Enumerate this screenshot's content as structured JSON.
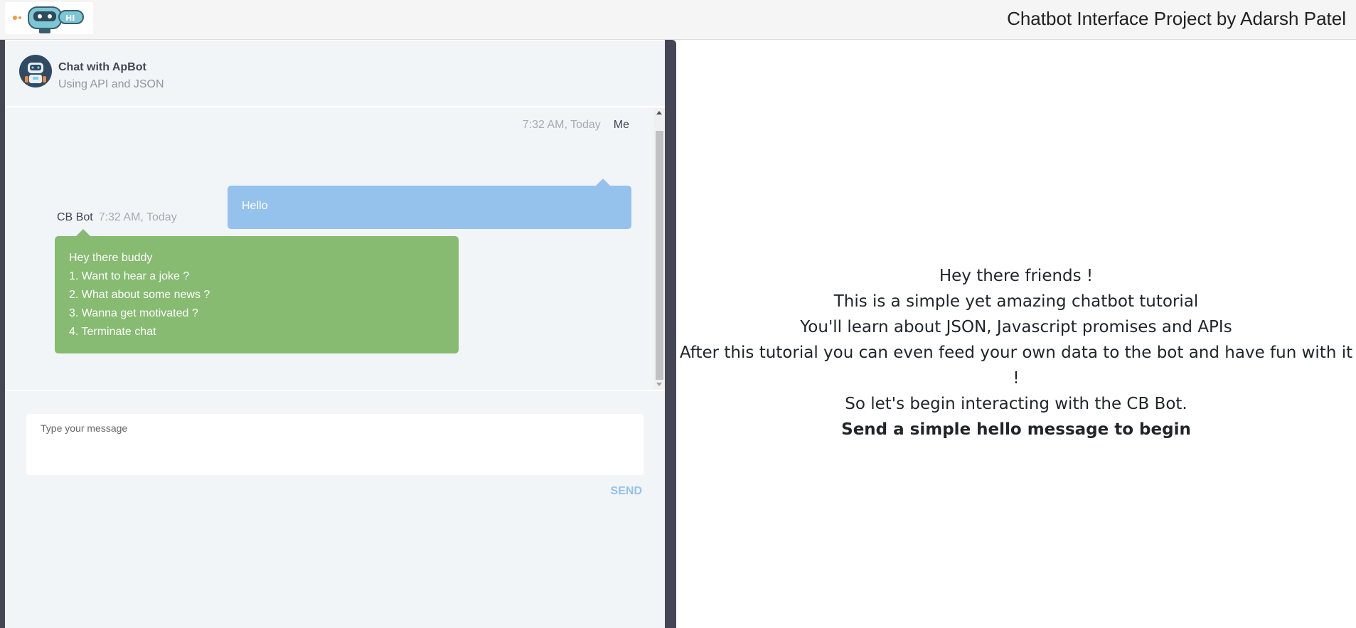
{
  "header": {
    "title": "Chatbot Interface Project by Adarsh Patel",
    "logo_icon": "robot-hi-logo-icon"
  },
  "chat": {
    "avatar_icon": "robot-avatar-icon",
    "title": "Chat with ApBot",
    "subtitle": "Using API and JSON",
    "messages": [
      {
        "sender": "Me",
        "time": "7:32 AM, Today",
        "lines": [
          "Hello"
        ]
      },
      {
        "sender": "CB Bot",
        "time": "7:32 AM, Today",
        "lines": [
          "Hey there buddy",
          "1. Want to hear a joke ?",
          "2. What about some news ?",
          "3. Wanna get motivated ?",
          "4. Terminate chat"
        ]
      }
    ],
    "input_placeholder": "Type your message",
    "send_label": "SEND"
  },
  "intro": {
    "lines": [
      "Hey there friends !",
      "This is a simple yet amazing chatbot tutorial",
      "You'll learn about JSON, Javascript promises and APIs",
      "After this tutorial you can even feed your own data to the bot and have fun with it",
      "!",
      "So let's begin interacting with the CB Bot."
    ],
    "cta": "Send a simple hello message to begin"
  },
  "colors": {
    "my_bubble": "#94c2ed",
    "bot_bubble": "#86bb71",
    "sidebar_dark": "#444753",
    "chat_bg": "#f2f5f8"
  }
}
